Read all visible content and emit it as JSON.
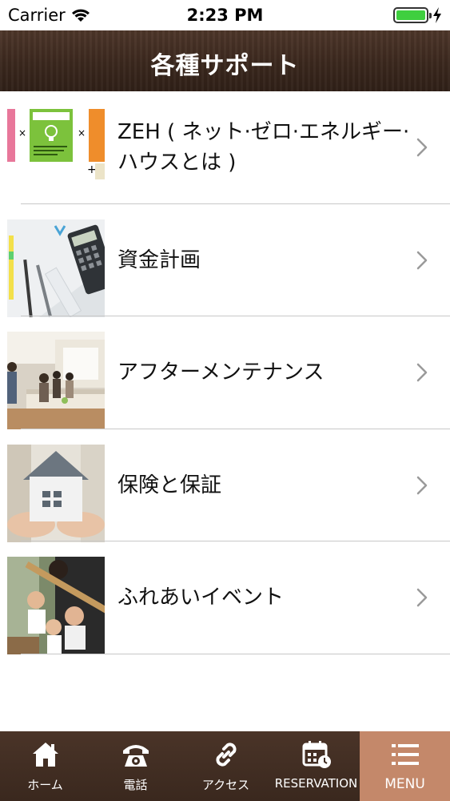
{
  "status_bar": {
    "carrier": "Carrier",
    "time": "2:23 PM",
    "battery_level": 1.0
  },
  "header": {
    "title": "各種サポート"
  },
  "list": [
    {
      "label": "ZEH ( ネット·ゼロ·エネルギー·ハウスとは )",
      "thumb_icon": "zeh-diagram-image"
    },
    {
      "label": "資金計画",
      "thumb_icon": "calculator-desk-image"
    },
    {
      "label": "アフターメンテナンス",
      "thumb_icon": "kitchen-people-image"
    },
    {
      "label": "保険と保証",
      "thumb_icon": "house-in-hands-image"
    },
    {
      "label": "ふれあいイベント",
      "thumb_icon": "family-event-image"
    }
  ],
  "tabbar": {
    "items": [
      {
        "label": "ホーム",
        "icon": "home-icon",
        "active": false
      },
      {
        "label": "電話",
        "icon": "phone-icon",
        "active": false
      },
      {
        "label": "アクセス",
        "icon": "link-icon",
        "active": false
      },
      {
        "label": "RESERVATION",
        "icon": "calendar-clock-icon",
        "active": false
      },
      {
        "label": "MENU",
        "icon": "menu-icon",
        "active": true
      }
    ]
  },
  "colors": {
    "header_bg": "#3a271d",
    "tabbar_bg": "#3f2d22",
    "tab_active_bg": "#c4886a",
    "battery": "#3fcf3f",
    "chevron": "#9a9a9a"
  }
}
